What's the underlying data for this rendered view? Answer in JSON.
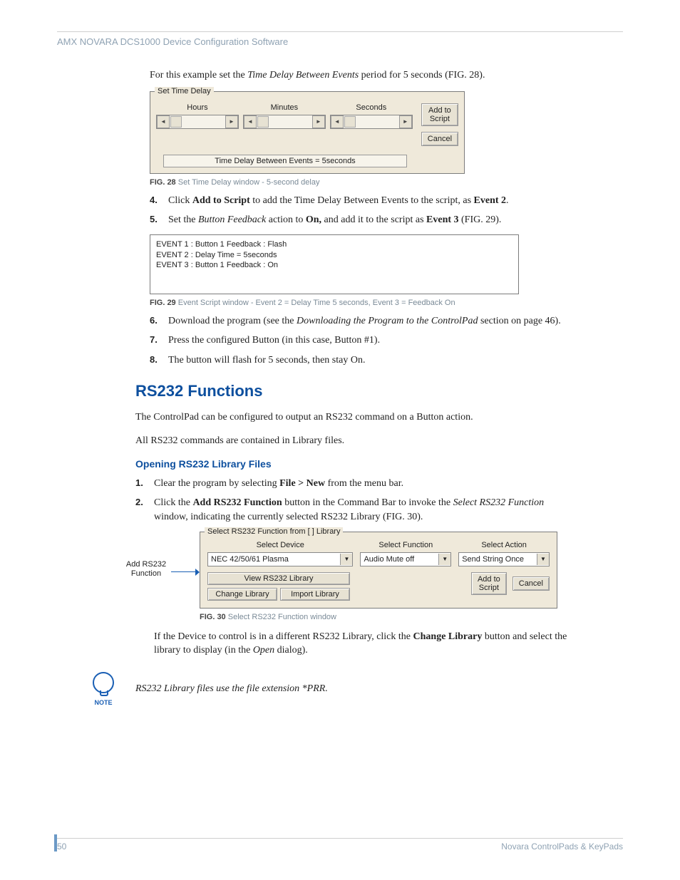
{
  "header": "AMX NOVARA DCS1000 Device Configuration Software",
  "intro": {
    "pre": "For this example set the ",
    "em": "Time Delay Between Events",
    "post": " period for 5 seconds (FIG. 28)."
  },
  "fig28": {
    "group_label": "Set Time Delay",
    "hours": "Hours",
    "minutes": "Minutes",
    "seconds": "Seconds",
    "add_to_script": "Add to\nScript",
    "cancel": "Cancel",
    "summary": "Time Delay Between Events =   5seconds",
    "caption_strong": "FIG. 28",
    "caption": "  Set Time Delay window - 5-second delay"
  },
  "listA": [
    {
      "n": "4.",
      "pre": "Click ",
      "b": "Add to Script",
      "post": " to add the Time Delay Between Events to the script, as ",
      "b2": "Event 2",
      "post2": "."
    },
    {
      "n": "5.",
      "pre": "Set the ",
      "em": "Button Feedback",
      "mid": " action to ",
      "b": "On,",
      "post": " and add it to the script as ",
      "b2": "Event 3",
      "post2": " (FIG. 29)."
    }
  ],
  "fig29": {
    "line1": "EVENT 1  : Button 1 Feedback : Flash",
    "line2": "EVENT 2  : Delay Time =   5seconds",
    "line3": "EVENT 3  : Button 1 Feedback : On",
    "caption_strong": "FIG. 29",
    "caption": "  Event Script window - Event 2 = Delay Time 5 seconds, Event 3 = Feedback On"
  },
  "listB": [
    {
      "n": "6.",
      "pre": "Download the program (see the ",
      "em": "Downloading the Program to the ControlPad",
      "post": " section on page 46)."
    },
    {
      "n": "7.",
      "txt": "Press the configured Button (in this case, Button #1)."
    },
    {
      "n": "8.",
      "txt": "The button will flash for 5 seconds, then stay On."
    }
  ],
  "rs232": {
    "title": "RS232 Functions",
    "p1": "The ControlPad can be configured to output an RS232 command on a Button action.",
    "p2": "All RS232 commands are contained in Library files.",
    "subtitle": "Opening RS232 Library Files"
  },
  "listC": [
    {
      "n": "1.",
      "pre": "Clear the program by selecting ",
      "b": "File > New",
      "post": " from the menu bar."
    },
    {
      "n": "2.",
      "pre": "Click the ",
      "b": "Add RS232 Function",
      "mid": " button in the Command Bar to invoke the ",
      "em": "Select RS232 Function",
      "post": " window, indicating the currently selected RS232 Library (FIG. 30)."
    }
  ],
  "fig30_label": "Add RS232\nFunction",
  "fig30": {
    "group_label": "Select RS232 Function from [   ] Library",
    "col1_label": "Select Device",
    "col1_value": "NEC 42/50/61   Plasma",
    "col2_label": "Select Function",
    "col2_value": "Audio Mute off",
    "col3_label": "Select Action",
    "col3_value": "Send String Once",
    "view_btn": "View RS232 Library",
    "change_btn": "Change Library",
    "import_btn": "Import Library",
    "add_btn": "Add to\nScript",
    "cancel_btn": "Cancel",
    "caption_strong": "FIG. 30",
    "caption": "  Select RS232 Function window"
  },
  "after30": {
    "pre": "If the Device to control is in a different RS232 Library, click the ",
    "b": "Change Library",
    "mid": " button and select the library to display (in the ",
    "em": "Open",
    "post": " dialog)."
  },
  "note": {
    "label": "NOTE",
    "text": "RS232 Library files use the file extension *PRR."
  },
  "footer": {
    "page": "50",
    "doc": "Novara ControlPads & KeyPads"
  }
}
